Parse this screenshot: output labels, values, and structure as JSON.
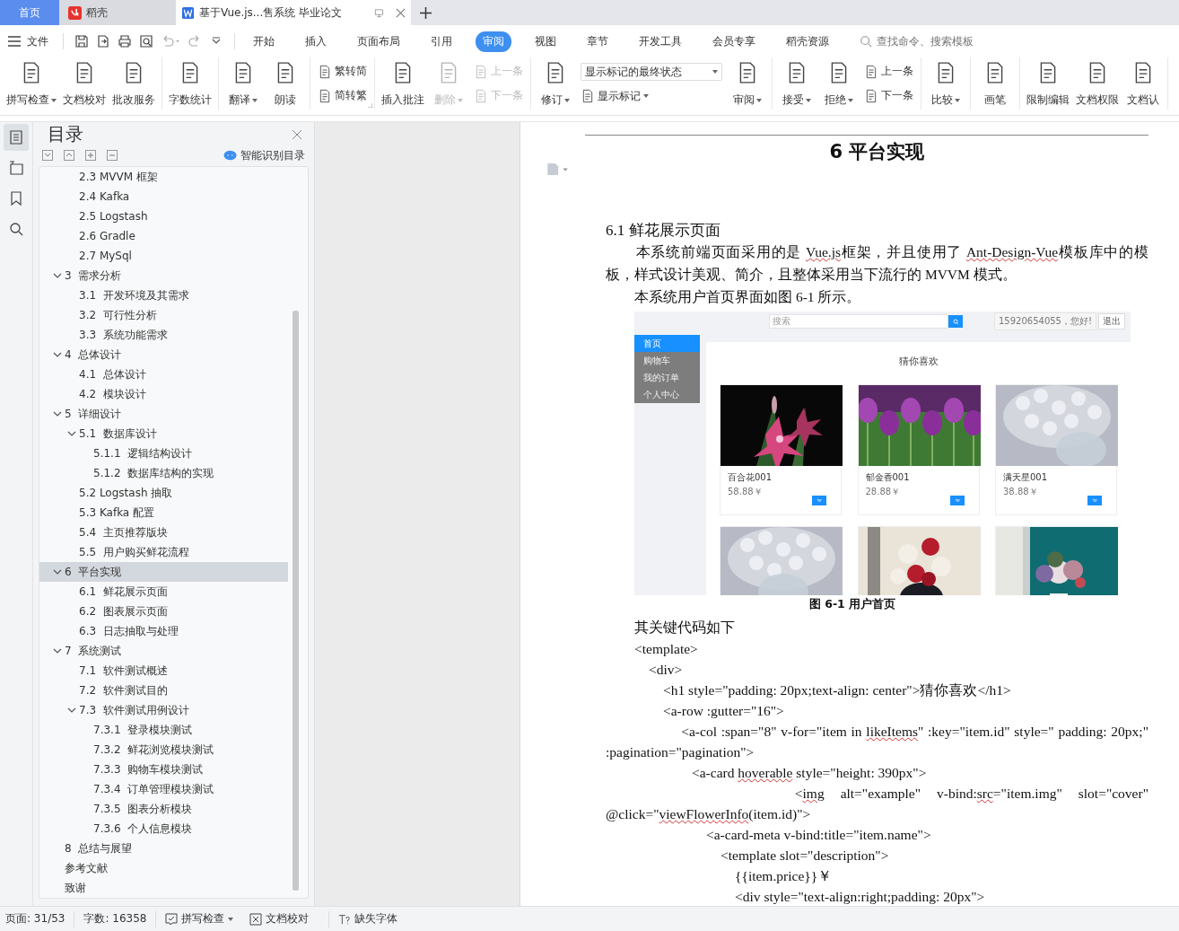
{
  "title_tabs": [
    {
      "kind": "home",
      "label": "首页",
      "selected": false
    },
    {
      "kind": "app",
      "label": "稻壳",
      "selected": false
    },
    {
      "kind": "document",
      "label": "基于Vue.js...售系统 毕业论文",
      "selected": true
    }
  ],
  "menu": {
    "file": "文件",
    "tabs": [
      {
        "label": "开始",
        "selected": false
      },
      {
        "label": "插入",
        "selected": false
      },
      {
        "label": "页面布局",
        "selected": false
      },
      {
        "label": "引用",
        "selected": false
      },
      {
        "label": "审阅",
        "selected": true
      },
      {
        "label": "视图",
        "selected": false
      },
      {
        "label": "章节",
        "selected": false
      },
      {
        "label": "开发工具",
        "selected": false
      },
      {
        "label": "会员专享",
        "selected": false
      },
      {
        "label": "稻壳资源",
        "selected": false
      }
    ],
    "search": {
      "placeholder": "查找命令、搜索模板"
    }
  },
  "ribbon": [
    {
      "launcher": false,
      "items": [
        {
          "kind": "large",
          "label": "拼写检查",
          "dropdown": true,
          "disabled": false
        },
        {
          "kind": "large",
          "label": "文档校对",
          "dropdown": false,
          "disabled": false
        },
        {
          "kind": "large",
          "label": "批改服务",
          "dropdown": false,
          "disabled": false
        }
      ]
    },
    {
      "launcher": false,
      "items": [
        {
          "kind": "large",
          "label": "字数统计",
          "dropdown": false,
          "disabled": false
        }
      ]
    },
    {
      "launcher": false,
      "items": [
        {
          "kind": "large",
          "label": "翻译",
          "dropdown": true,
          "disabled": false
        },
        {
          "kind": "large",
          "label": "朗读",
          "dropdown": false,
          "disabled": false
        }
      ]
    },
    {
      "launcher": true,
      "items": [
        {
          "kind": "stack",
          "rows": [
            {
              "label": "繁转简",
              "disabled": false
            },
            {
              "label": "简转繁",
              "disabled": false
            }
          ]
        }
      ]
    },
    {
      "launcher": false,
      "items": [
        {
          "kind": "large",
          "label": "插入批注",
          "dropdown": false,
          "disabled": false
        },
        {
          "kind": "large",
          "label": "删除",
          "dropdown": true,
          "disabled": true
        },
        {
          "kind": "stack",
          "rows": [
            {
              "label": "上一条",
              "disabled": true
            },
            {
              "label": "下一条",
              "disabled": true
            }
          ]
        }
      ]
    },
    {
      "launcher": false,
      "items": [
        {
          "kind": "large",
          "label": "修订",
          "dropdown": true,
          "disabled": false
        },
        {
          "kind": "select",
          "value": "显示标记的最终状态",
          "below": "显示标记"
        },
        {
          "kind": "large",
          "label": "审阅",
          "dropdown": true,
          "disabled": false
        }
      ]
    },
    {
      "launcher": false,
      "items": [
        {
          "kind": "large",
          "label": "接受",
          "dropdown": true,
          "disabled": false
        },
        {
          "kind": "large",
          "label": "拒绝",
          "dropdown": true,
          "disabled": false
        },
        {
          "kind": "stack",
          "rows": [
            {
              "label": "上一条",
              "disabled": false
            },
            {
              "label": "下一条",
              "disabled": false
            }
          ]
        }
      ]
    },
    {
      "launcher": false,
      "items": [
        {
          "kind": "large",
          "label": "比较",
          "dropdown": true,
          "disabled": false
        }
      ]
    },
    {
      "launcher": false,
      "items": [
        {
          "kind": "large",
          "label": "画笔",
          "dropdown": false,
          "disabled": false
        }
      ]
    },
    {
      "launcher": false,
      "items": [
        {
          "kind": "large",
          "label": "限制编辑",
          "dropdown": false,
          "disabled": false
        },
        {
          "kind": "large",
          "label": "文档权限",
          "dropdown": false,
          "disabled": false
        },
        {
          "kind": "large",
          "label": "文档认",
          "dropdown": false,
          "disabled": false
        }
      ]
    }
  ],
  "side_tools": [
    {
      "selected": true
    },
    {
      "selected": false
    },
    {
      "selected": false
    },
    {
      "selected": false
    }
  ],
  "toc": {
    "title": "目录",
    "action": "智能识别目录",
    "leading_items": [
      {
        "label": "2.3 MVVM 框架",
        "selected": false
      },
      {
        "label": "2.4 Kafka",
        "selected": false
      },
      {
        "label": "2.5 Logstash",
        "selected": false
      },
      {
        "label": "2.6 Gradle",
        "selected": false
      },
      {
        "label": "2.7 MySql",
        "selected": false
      }
    ],
    "items": [
      {
        "label": "3  需求分析",
        "selected": false,
        "expanded": true,
        "children": [
          {
            "label": "3.1  开发环境及其需求",
            "selected": false
          },
          {
            "label": "3.2  可行性分析",
            "selected": false
          },
          {
            "label": "3.3  系统功能需求",
            "selected": false
          }
        ]
      },
      {
        "label": "4  总体设计",
        "selected": false,
        "expanded": true,
        "children": [
          {
            "label": "4.1  总体设计",
            "selected": false
          },
          {
            "label": "4.2  模块设计",
            "selected": false
          }
        ]
      },
      {
        "label": "5  详细设计",
        "selected": false,
        "expanded": true,
        "children": [
          {
            "label": "5.1  数据库设计",
            "selected": false,
            "expanded": true,
            "children": [
              {
                "label": "5.1.1  逻辑结构设计",
                "selected": false
              },
              {
                "label": "5.1.2  数据库结构的实现",
                "selected": false
              }
            ]
          },
          {
            "label": "5.2 Logstash 抽取",
            "selected": false
          },
          {
            "label": "5.3 Kafka 配置",
            "selected": false
          },
          {
            "label": "5.4  主页推荐版块",
            "selected": false
          },
          {
            "label": "5.5  用户购买鲜花流程",
            "selected": false
          }
        ]
      },
      {
        "label": "6  平台实现",
        "selected": true,
        "expanded": true,
        "children": [
          {
            "label": "6.1  鲜花展示页面",
            "selected": false
          },
          {
            "label": "6.2  图表展示页面",
            "selected": false
          },
          {
            "label": "6.3  日志抽取与处理",
            "selected": false
          }
        ]
      },
      {
        "label": "7  系统测试",
        "selected": false,
        "expanded": true,
        "children": [
          {
            "label": "7.1  软件测试概述",
            "selected": false
          },
          {
            "label": "7.2  软件测试目的",
            "selected": false
          },
          {
            "label": "7.3  软件测试用例设计",
            "selected": false,
            "expanded": true,
            "children": [
              {
                "label": "7.3.1  登录模块测试",
                "selected": false
              },
              {
                "label": "7.3.2  鲜花浏览模块测试",
                "selected": false
              },
              {
                "label": "7.3.3  购物车模块测试",
                "selected": false
              },
              {
                "label": "7.3.4  订单管理模块测试",
                "selected": false
              },
              {
                "label": "7.3.5  图表分析模块",
                "selected": false
              },
              {
                "label": "7.3.6  个人信息模块",
                "selected": false
              }
            ]
          }
        ]
      },
      {
        "label": "8  总结与展望",
        "selected": false
      },
      {
        "label": "参考文献",
        "selected": false
      },
      {
        "label": "致谢",
        "selected": false
      }
    ]
  },
  "document": {
    "heading": "6  平台实现",
    "section_number": "6.1",
    "section_title": "鲜花展示页面",
    "blocks": [
      {
        "kind": "text",
        "segments": [
          {
            "text": "　　本系统前端页面采用的是 ",
            "flagged": false
          },
          {
            "text": "Vue.js",
            "flagged": true
          },
          {
            "text": "框架，并且使用了 ",
            "flagged": false
          },
          {
            "text": "Ant-Design-Vue",
            "flagged": true
          },
          {
            "text": "模板库中的模板，样式设计美观、简介，且整体采用当下流行的 MVVM 模式。",
            "flagged": false
          }
        ]
      },
      {
        "kind": "text",
        "text": "　　本系统用户首页界面如图 6-1 所示。"
      },
      {
        "kind": "figure",
        "app": {
          "search_placeholder": "搜索",
          "user": "15920654055，您好!",
          "logout": "退出",
          "nav": [
            {
              "label": "首页",
              "selected": true
            },
            {
              "label": "购物车",
              "selected": false
            },
            {
              "label": "我的订单",
              "selected": false
            },
            {
              "label": "个人中心",
              "selected": false
            }
          ],
          "heading": "猜你喜欢",
          "cards": [
            {
              "kind": "picture",
              "name": "百合花001",
              "price": "58.88￥"
            },
            {
              "kind": "picture",
              "name": "郁金香001",
              "price": "28.88￥"
            },
            {
              "kind": "picture",
              "name": "满天星001",
              "price": "38.88￥"
            },
            {
              "kind": "picture"
            },
            {
              "kind": "picture"
            },
            {
              "kind": "picture"
            }
          ]
        }
      },
      {
        "kind": "caption",
        "text": "图 6-1  用户首页"
      },
      {
        "kind": "text",
        "text": "　　其关键代码如下"
      },
      {
        "kind": "code",
        "text": "　　<template>"
      },
      {
        "kind": "code",
        "text": "　　　<div>"
      },
      {
        "kind": "code",
        "text": "　　　　<h1 style=\"padding: 20px;text-align: center\">猜你喜欢</h1>"
      },
      {
        "kind": "code",
        "text": "　　　　<a-row :gutter=\"16\">"
      },
      {
        "kind": "code",
        "segments": [
          {
            "text": "　　　　　<a-col :span=\"8\" v-for=\"item in ",
            "flagged": false
          },
          {
            "text": "likeItems",
            "flagged": true
          },
          {
            "text": "\" :key=\"item.id\" style=\" padding: 20px;\" :pagination=\"pagination\">",
            "flagged": false
          }
        ]
      },
      {
        "kind": "code",
        "segments": [
          {
            "text": "　　　　　　<a-card ",
            "flagged": false
          },
          {
            "text": "hoverable",
            "flagged": true
          },
          {
            "text": " style=\"height: 390px\">",
            "flagged": false
          }
        ]
      },
      {
        "kind": "code",
        "segments": [
          {
            "text": "　　　　　　　<",
            "flagged": false
          },
          {
            "text": "img",
            "flagged": true
          },
          {
            "text": " alt=\"example\" v-bind:",
            "flagged": false
          },
          {
            "text": "src",
            "flagged": true
          },
          {
            "text": "=\"item.img\" slot=\"cover\" @click=\"",
            "flagged": false
          },
          {
            "text": "viewFlowerInfo",
            "flagged": true
          },
          {
            "text": "(item.id)\">",
            "flagged": false
          }
        ]
      },
      {
        "kind": "code",
        "text": "　　　　　　　<a-card-meta v-bind:title=\"item.name\">"
      },
      {
        "kind": "code",
        "text": "　　　　　　　　<template slot=\"description\">"
      },
      {
        "kind": "code",
        "text": "　　　　　　　　　{{item.price}}￥"
      },
      {
        "kind": "code",
        "text": "　　　　　　　　　<div style=\"text-align:right;padding: 20px\">"
      }
    ]
  },
  "status_bar": {
    "page": "页面: 31/53",
    "words": "字数: 16358",
    "spellcheck": "拼写检查",
    "proofread": "文档校对",
    "fonts": "缺失字体"
  }
}
